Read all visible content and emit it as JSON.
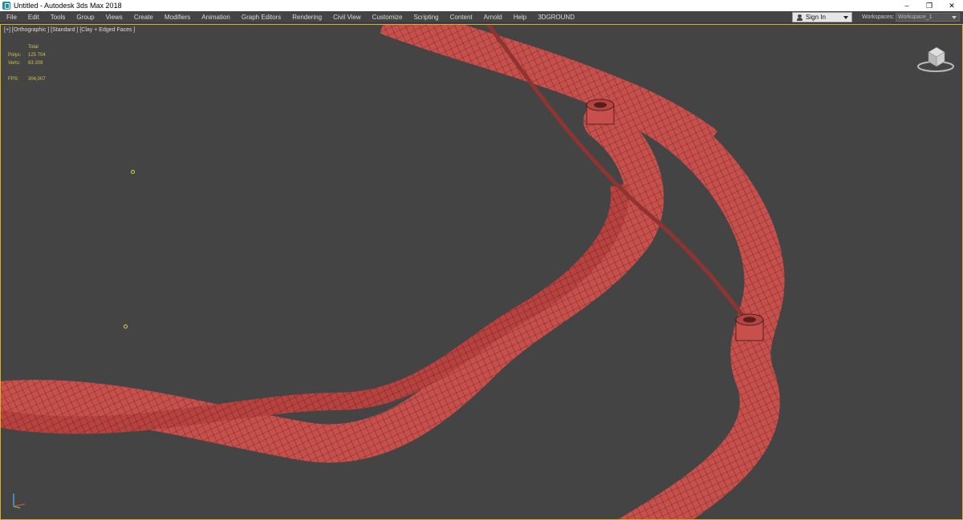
{
  "titlebar": {
    "title": "Untitled - Autodesk 3ds Max 2018",
    "minimize": "–",
    "restore": "❐",
    "close": "✕"
  },
  "menu": [
    "File",
    "Edit",
    "Tools",
    "Group",
    "Views",
    "Create",
    "Modifiers",
    "Animation",
    "Graph Editors",
    "Rendering",
    "Civil View",
    "Customize",
    "Scripting",
    "Content",
    "Arnold",
    "Help",
    "3DGROUND"
  ],
  "signin": {
    "label": "Sign In"
  },
  "workspaces": {
    "label": "Workspaces:",
    "value": "Workspace_1"
  },
  "viewport": {
    "label": "[+] [Orthographic ] [Standard ] [Clay + Edged Faces ]",
    "stats": {
      "total_label": "Total",
      "polys_label": "Polys:",
      "polys_value": "125 704",
      "verts_label": "Verts:",
      "verts_value": "63 209",
      "fps_label": "FPS:",
      "fps_value": "304,007"
    }
  },
  "colors": {
    "mesh": "#c8504c",
    "mesh_edge": "#3a1414",
    "viewport_bg": "#444444",
    "stats_text": "#d6c24a",
    "active_border": "#d8b030"
  }
}
